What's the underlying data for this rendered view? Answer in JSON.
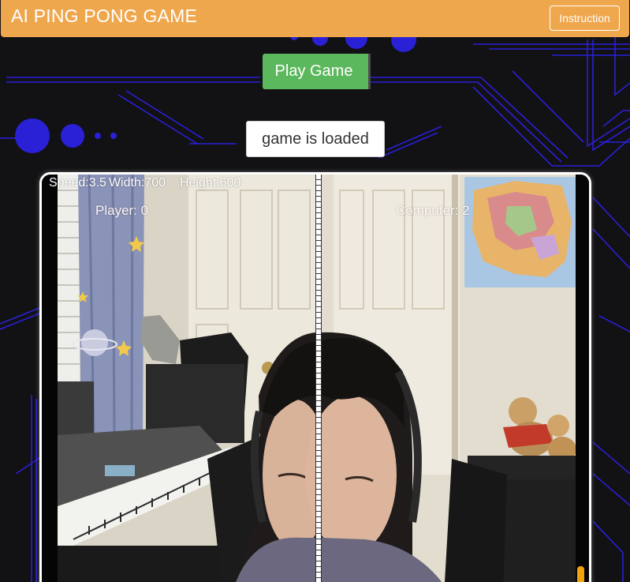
{
  "header": {
    "title": "AI PING PONG GAME",
    "instruction_label": "Instruction",
    "background_color": "#efa74e"
  },
  "controls": {
    "play_label": "Play Game",
    "play_color": "#5cb85c",
    "status_text": "game is loaded"
  },
  "game": {
    "speed_text": "Speed:3.5",
    "width_text": "Width:700",
    "height_text": "Height:600",
    "player_score_text": "Player: 0",
    "computer_score_text": "Computer: 2",
    "paddle_color": "#f2a20d"
  },
  "theme": {
    "background": "#121114",
    "circuit_color": "#2a20d6"
  }
}
